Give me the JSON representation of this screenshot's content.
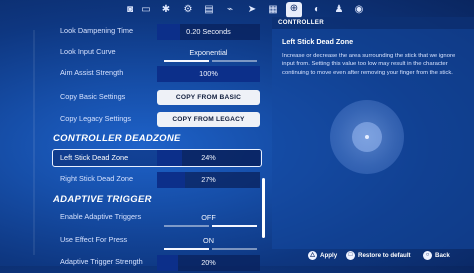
{
  "topbar": {
    "tabs": [
      {
        "icon": "camera-icon",
        "glyph": "◙"
      },
      {
        "icon": "monitor-icon",
        "glyph": "▭"
      },
      {
        "icon": "gear-icon",
        "glyph": "✱"
      },
      {
        "icon": "gear-alt-icon",
        "glyph": "⚙"
      },
      {
        "icon": "video-icon",
        "glyph": "▤"
      },
      {
        "icon": "wifi-icon",
        "glyph": "⌁"
      },
      {
        "icon": "cursor-icon",
        "glyph": "➤"
      },
      {
        "icon": "dashboard-icon",
        "glyph": "▦"
      },
      {
        "icon": "controller-icon",
        "glyph": "⊕"
      },
      {
        "icon": "gamepad-icon",
        "glyph": "◐"
      },
      {
        "icon": "person-icon",
        "glyph": "♟"
      },
      {
        "icon": "account-icon",
        "glyph": "◉"
      }
    ]
  },
  "settings": {
    "look_dampening_time": {
      "label": "Look Dampening Time",
      "value": "0.20 Seconds"
    },
    "look_input_curve": {
      "label": "Look Input Curve",
      "value": "Exponential"
    },
    "aim_assist_strength": {
      "label": "Aim Assist Strength",
      "value": "100%",
      "level": 1.0
    },
    "copy_basic": {
      "label": "Copy Basic Settings",
      "button": "COPY FROM BASIC"
    },
    "copy_legacy": {
      "label": "Copy Legacy Settings",
      "button": "COPY FROM LEGACY"
    },
    "controller_deadzone_title": "CONTROLLER DEADZONE",
    "left_stick_dead_zone": {
      "label": "Left Stick Dead Zone",
      "value": "24%",
      "level": 0.24
    },
    "right_stick_dead_zone": {
      "label": "Right Stick Dead Zone",
      "value": "27%",
      "level": 0.27
    },
    "adaptive_trigger_title": "ADAPTIVE TRIGGER",
    "enable_adaptive_triggers": {
      "label": "Enable Adaptive Triggers",
      "value": "OFF"
    },
    "use_effect_for_press": {
      "label": "Use Effect For Press",
      "value": "ON"
    },
    "adaptive_trigger_strength": {
      "label": "Adaptive Trigger Strength",
      "value": "20%"
    }
  },
  "panel": {
    "header": "CONTROLLER",
    "title": "Left Stick Dead Zone",
    "description": "Increase or decrease the area surrounding the stick that we ignore input from.  Setting this value too low may result in the character continuing to move even after removing your finger from the stick."
  },
  "footer": {
    "apply": {
      "glyph": "△",
      "label": "Apply"
    },
    "restore": {
      "glyph": "□",
      "label": "Restore to default"
    },
    "back": {
      "glyph": "○",
      "label": "Back"
    }
  },
  "colors": {
    "accent_fill": "#0c2f8a",
    "selected_border": "#e9f0ff"
  }
}
